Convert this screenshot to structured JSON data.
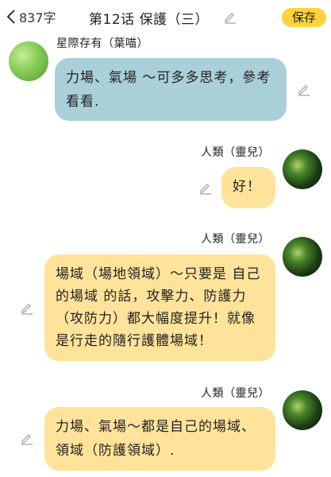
{
  "header": {
    "word_count": "837字",
    "title": "第12话 保護（三）",
    "save_label": "保存"
  },
  "messages": [
    {
      "name": "星際存有（葉喵）",
      "text": "力場、氣場 ～可多多思考，參考看看."
    },
    {
      "name": "人類（靈兒）",
      "text": "好！"
    },
    {
      "name": "人類（靈兒）",
      "text": "場域（場地領域）～只要是 自己的場域 的話，攻擊力、防護力（攻防力）都大幅度提升！就像是行走的隨行護體場域！"
    },
    {
      "name": "人類（靈兒）",
      "text": "力場、氣場～都是自己的場域、領域（防護領域）."
    }
  ],
  "icons": {
    "back": "chevron-left-icon",
    "edit": "pencil-icon"
  },
  "colors": {
    "save_button": "#ffd43b",
    "bubble_blue": "#a9cfd9",
    "bubble_yellow": "#ffe39a"
  }
}
